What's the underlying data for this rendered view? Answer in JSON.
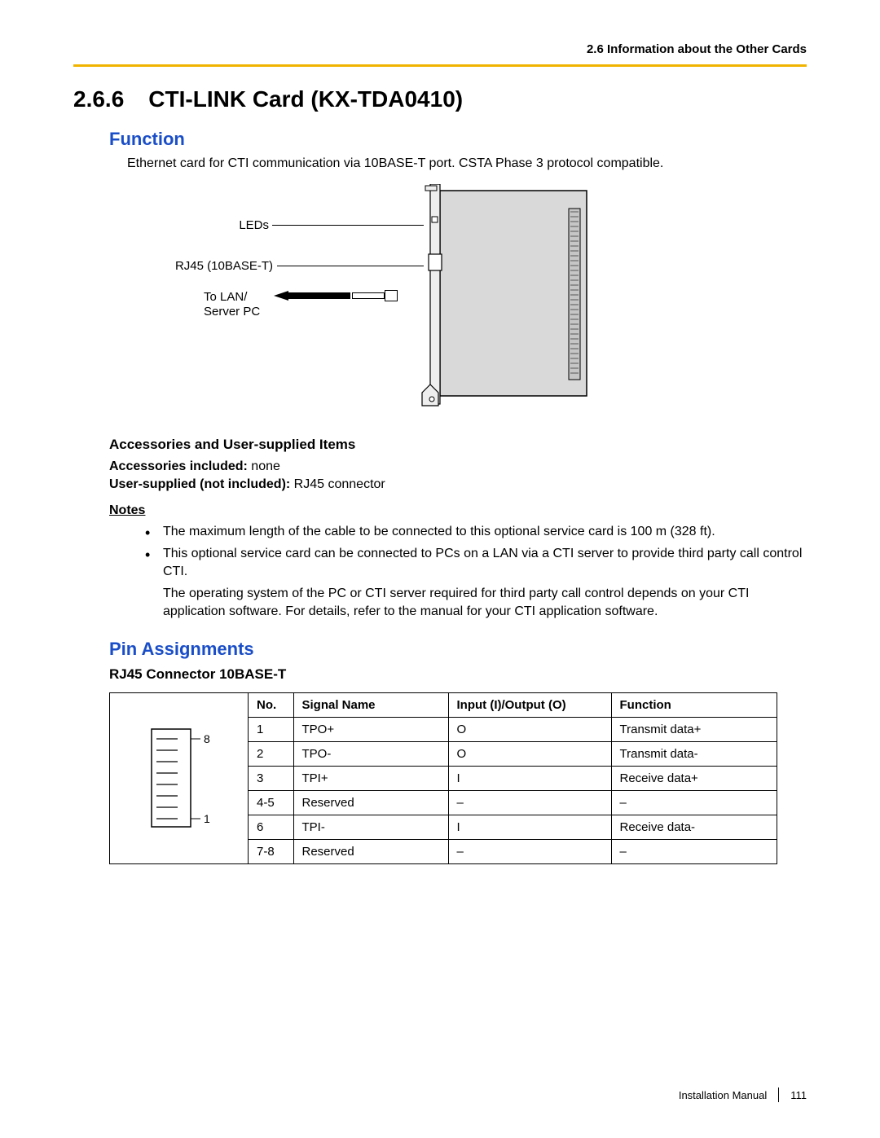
{
  "header": {
    "right": "2.6 Information about the Other Cards"
  },
  "section": {
    "number": "2.6.6",
    "title": "CTI-LINK Card (KX-TDA0410)"
  },
  "function": {
    "heading": "Function",
    "text": "Ethernet card for CTI communication via 10BASE-T port. CSTA Phase 3 protocol compatible."
  },
  "figure_labels": {
    "leds": "LEDs",
    "rj45": "RJ45 (10BASE-T)",
    "to_lan": "To LAN/",
    "server_pc": "Server PC"
  },
  "accessories": {
    "heading": "Accessories and User-supplied Items",
    "included_label": "Accessories included:",
    "included_value": "none",
    "user_label": "User-supplied (not included):",
    "user_value": "RJ45 connector"
  },
  "notes": {
    "label": "Notes",
    "items": [
      "The maximum length of the cable to be connected to this optional service card is 100 m (328 ft).",
      "This optional service card can be connected to PCs on a LAN via a CTI server to provide third party call control CTI."
    ],
    "sub": "The operating system of the PC or CTI server required for third party call control depends on your CTI application software. For details, refer to the manual for your CTI application software."
  },
  "pin": {
    "heading": "Pin Assignments",
    "subheading": "RJ45 Connector 10BASE-T",
    "columns": [
      "No.",
      "Signal Name",
      "Input (I)/Output (O)",
      "Function"
    ],
    "diagram": {
      "top_pin": "8",
      "bottom_pin": "1"
    }
  },
  "chart_data": {
    "type": "table",
    "title": "RJ45 Connector 10BASE-T Pin Assignments",
    "columns": [
      "No.",
      "Signal Name",
      "Input (I)/Output (O)",
      "Function"
    ],
    "rows": [
      [
        "1",
        "TPO+",
        "O",
        "Transmit data+"
      ],
      [
        "2",
        "TPO-",
        "O",
        "Transmit data-"
      ],
      [
        "3",
        "TPI+",
        "I",
        "Receive data+"
      ],
      [
        "4-5",
        "Reserved",
        "–",
        "–"
      ],
      [
        "6",
        "TPI-",
        "I",
        "Receive data-"
      ],
      [
        "7-8",
        "Reserved",
        "–",
        "–"
      ]
    ]
  },
  "footer": {
    "book": "Installation Manual",
    "page": "111"
  }
}
